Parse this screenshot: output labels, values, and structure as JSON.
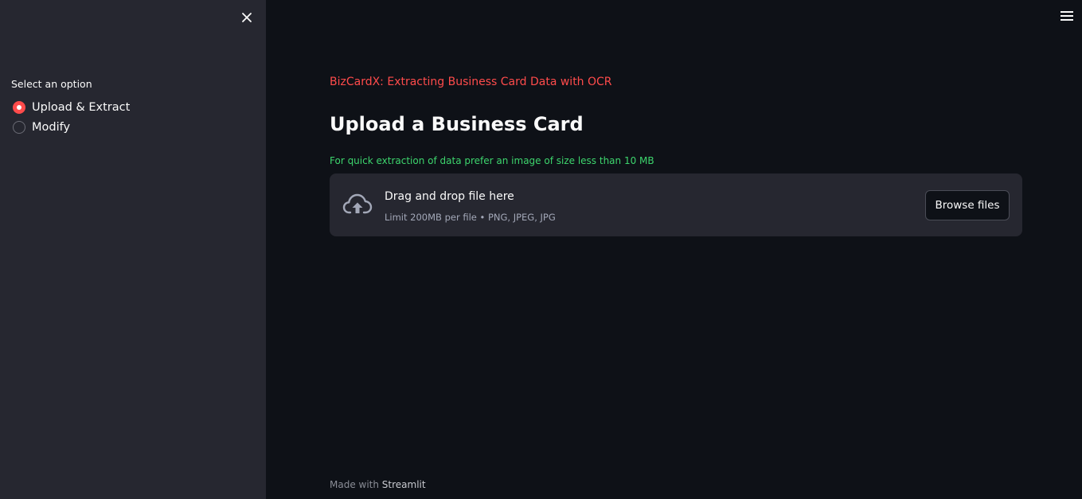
{
  "sidebar": {
    "close_icon": "close-icon",
    "radio_label": "Select an option",
    "options": [
      {
        "label": "Upload & Extract",
        "selected": true
      },
      {
        "label": "Modify",
        "selected": false
      }
    ]
  },
  "header": {
    "menu_icon": "hamburger-menu-icon"
  },
  "main": {
    "subtitle": "BizCardX: Extracting Business Card Data with OCR",
    "title": "Upload a Business Card",
    "hint": "For quick extraction of data prefer an image of size less than 10 MB",
    "uploader": {
      "icon": "cloud-upload-icon",
      "title": "Drag and drop file here",
      "limit": "Limit 200MB per file • PNG, JPEG, JPG",
      "button_label": "Browse files"
    }
  },
  "footer": {
    "prefix": "Made with ",
    "brand": "Streamlit"
  },
  "colors": {
    "accent": "#ff4b4b",
    "hint": "#3dd56d",
    "sidebar_bg": "#262730",
    "main_bg": "#0e1117"
  }
}
